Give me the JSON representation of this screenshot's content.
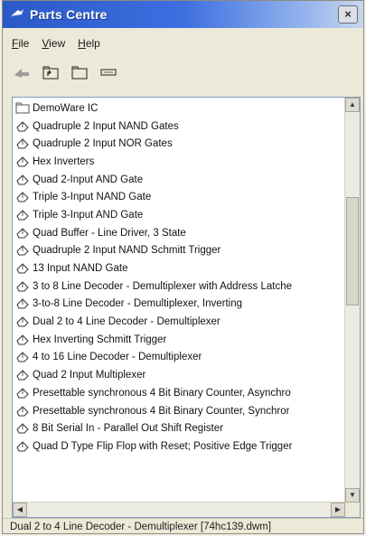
{
  "window": {
    "title": "Parts Centre",
    "close_glyph": "×"
  },
  "menu": [
    {
      "label": "File",
      "underline": "F",
      "rest": "ile"
    },
    {
      "label": "View",
      "underline": "V",
      "rest": "iew"
    },
    {
      "label": "Help",
      "underline": "H",
      "rest": "elp"
    }
  ],
  "toolbar": {
    "icons": [
      "back-arrow-icon",
      "parent-folder-icon",
      "new-folder-icon",
      "part-icon"
    ]
  },
  "list": {
    "items": [
      {
        "label": "DemoWare IC",
        "icon": "folder-icon"
      },
      {
        "label": "Quadruple 2 Input NAND Gates",
        "icon": "chip-icon"
      },
      {
        "label": "Quadruple 2 Input NOR Gates",
        "icon": "chip-icon"
      },
      {
        "label": "Hex Inverters",
        "icon": "chip-icon"
      },
      {
        "label": "Quad 2-Input AND Gate",
        "icon": "chip-icon"
      },
      {
        "label": "Triple 3-Input NAND Gate",
        "icon": "chip-icon"
      },
      {
        "label": "Triple 3-Input AND Gate",
        "icon": "chip-icon"
      },
      {
        "label": "Quad Buffer - Line Driver, 3 State",
        "icon": "chip-icon"
      },
      {
        "label": "Quadruple 2 Input NAND Schmitt Trigger",
        "icon": "chip-icon"
      },
      {
        "label": "13 Input NAND Gate",
        "icon": "chip-icon"
      },
      {
        "label": "3 to 8 Line Decoder - Demultiplexer with Address Latche",
        "icon": "chip-icon"
      },
      {
        "label": "3-to-8 Line Decoder - Demultiplexer, Inverting",
        "icon": "chip-icon"
      },
      {
        "label": "Dual 2 to 4 Line Decoder - Demultiplexer",
        "icon": "chip-icon"
      },
      {
        "label": "Hex Inverting Schmitt Trigger",
        "icon": "chip-icon"
      },
      {
        "label": "4 to 16 Line Decoder - Demultiplexer",
        "icon": "chip-icon"
      },
      {
        "label": "Quad 2 Input Multiplexer",
        "icon": "chip-icon"
      },
      {
        "label": "Presettable synchronous 4 Bit Binary Counter, Asynchro",
        "icon": "chip-icon"
      },
      {
        "label": "Presettable synchronous 4 Bit Binary Counter, Synchror",
        "icon": "chip-icon"
      },
      {
        "label": "8 Bit Serial In - Parallel Out Shift Register",
        "icon": "chip-icon"
      },
      {
        "label": "Quad D Type Flip Flop with Reset; Positive Edge Trigger",
        "icon": "chip-icon"
      }
    ]
  },
  "status": {
    "text": "Dual 2 to 4 Line Decoder - Demultiplexer [74hc139.dwm]"
  },
  "colors": {
    "title_start": "#2a59c7",
    "title_end": "#c9d6ee",
    "list_border": "#7f9db9"
  }
}
